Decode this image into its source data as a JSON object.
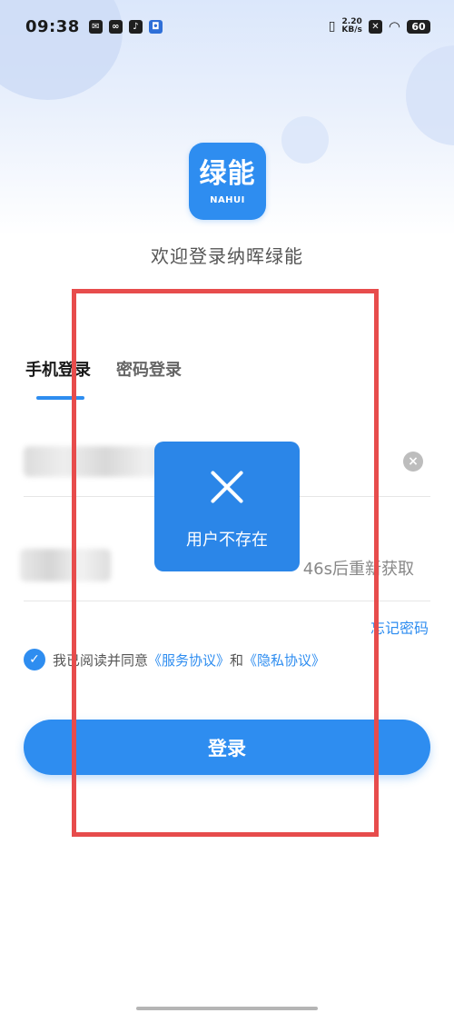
{
  "status_bar": {
    "time": "09:38",
    "net_speed_value": "2.20",
    "net_speed_unit": "KB/s",
    "battery": "60"
  },
  "app": {
    "logo_cn": "绿能",
    "logo_en": "NAHUI",
    "welcome": "欢迎登录纳晖绿能"
  },
  "tabs": [
    {
      "label": "手机登录",
      "active": true
    },
    {
      "label": "密码登录",
      "active": false
    }
  ],
  "form": {
    "phone_value": "",
    "code_value": "",
    "code_button": "46s后重新获取",
    "forgot_password": "忘记密码"
  },
  "agreement": {
    "prefix": "我已阅读并同意",
    "service": "《服务协议》",
    "and": "和",
    "privacy": "《隐私协议》"
  },
  "login_button": "登录",
  "toast": {
    "message": "用户不存在"
  },
  "colors": {
    "primary": "#2e8df0",
    "annotation": "#e74c4c"
  }
}
